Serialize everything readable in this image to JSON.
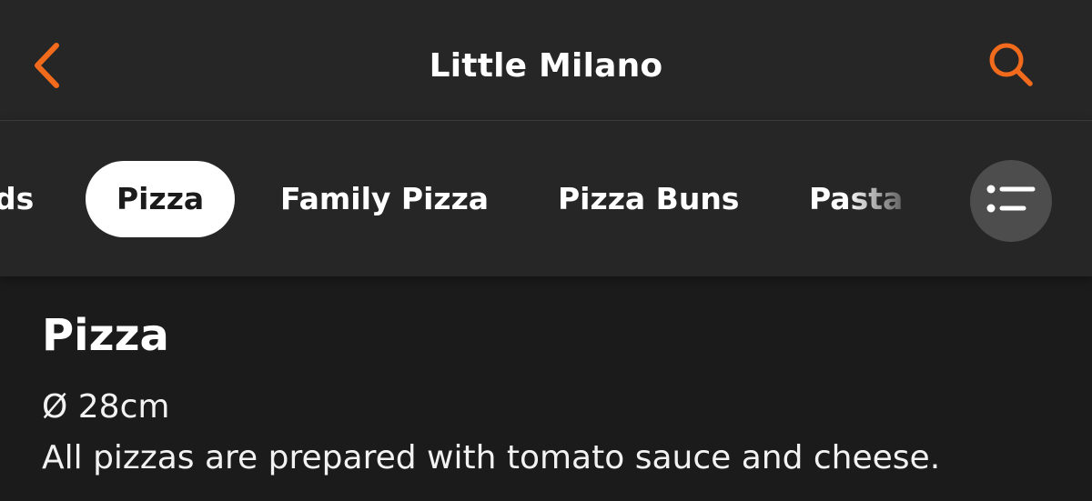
{
  "header": {
    "title": "Little Milano",
    "back_icon": "chevron-left-icon",
    "search_icon": "search-icon",
    "accent_color": "#f26b1d"
  },
  "categories": {
    "items": [
      {
        "label": "ds",
        "selected": false
      },
      {
        "label": "Pizza",
        "selected": true
      },
      {
        "label": "Family Pizza",
        "selected": false
      },
      {
        "label": "Pizza Buns",
        "selected": false
      },
      {
        "label": "Pasta",
        "selected": false
      }
    ],
    "menu_icon": "list-icon"
  },
  "section": {
    "title": "Pizza",
    "size_text": "Ø 28cm",
    "description": "All pizzas are prepared with tomato sauce and cheese."
  }
}
